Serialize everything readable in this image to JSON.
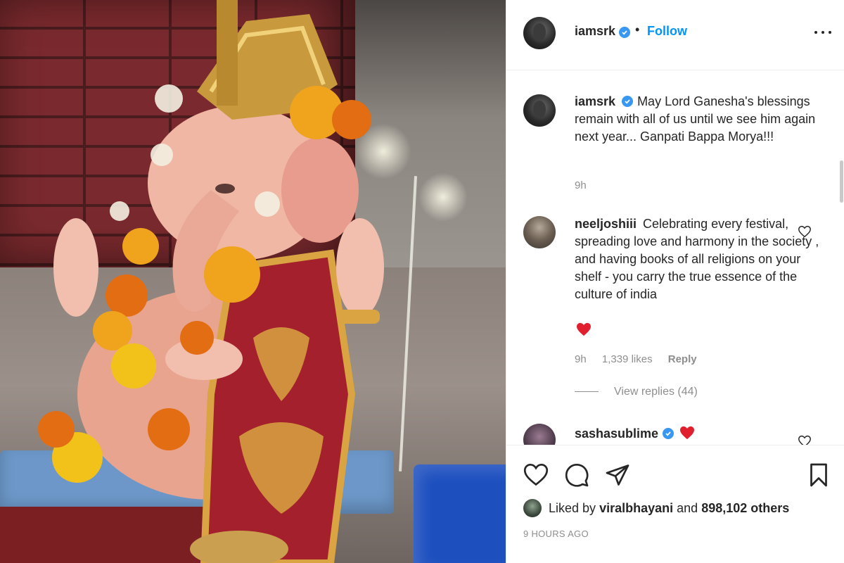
{
  "post": {
    "username": "iamsrk",
    "dot": "•",
    "follow_label": "Follow",
    "more_icon": "more-options-icon"
  },
  "caption": {
    "username": "iamsrk",
    "text": "May Lord Ganesha's blessings remain with all of us until we see him again next year... Ganpati Bappa Morya!!!",
    "time": "9h"
  },
  "comments": [
    {
      "username": "neeljoshiii",
      "text": "Celebrating every festival, spreading love and harmony in the society , and having books of all religions on your shelf - you carry the true essence of the culture of india",
      "emoji": "red-heart-emoji",
      "time": "9h",
      "likes": "1,339 likes",
      "reply_label": "Reply",
      "view_replies": "View replies (44)"
    },
    {
      "username": "sashasublime",
      "emoji": "red-heart-emoji"
    }
  ],
  "footer": {
    "liked_prefix": "Liked by",
    "liked_user": "viralbhayani",
    "liked_and": "and",
    "liked_count": "898,102 others",
    "time_ago": "9 HOURS AGO"
  },
  "colors": {
    "follow": "#0095f6",
    "verified": "#3897f0",
    "heart": "#ed4956",
    "secondary_text": "#8e8e8e"
  }
}
